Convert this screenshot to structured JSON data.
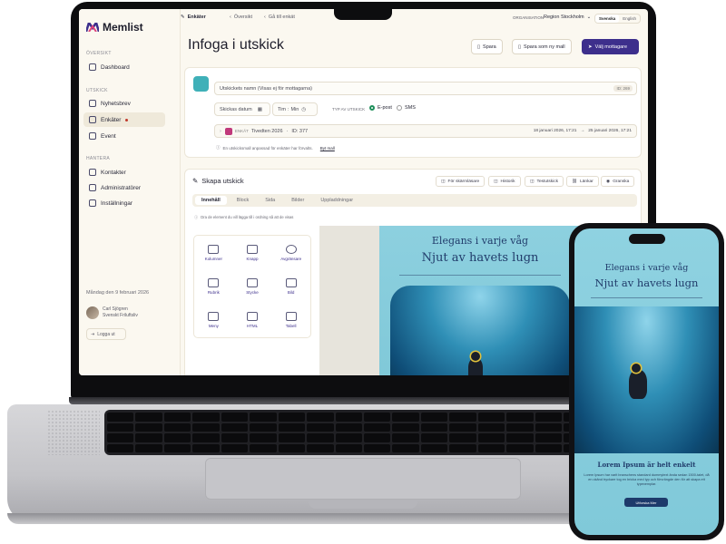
{
  "app": {
    "logo_text": "Memlist",
    "brand_color": "#3d2f8c",
    "accent_teal": "#3fb0b8"
  },
  "sidebar": {
    "section_overview": "ÖVERSIKT",
    "section_outreach": "UTSKICK",
    "section_manage": "HANTERA",
    "items": [
      {
        "label": "Dashboard",
        "icon": "dashboard-icon"
      },
      {
        "label": "Nyhetsbrev",
        "icon": "newsletter-icon"
      },
      {
        "label": "Enkäter",
        "icon": "survey-icon"
      },
      {
        "label": "Event",
        "icon": "event-icon"
      },
      {
        "label": "Kontakter",
        "icon": "contacts-icon"
      },
      {
        "label": "Administratörer",
        "icon": "admins-icon"
      },
      {
        "label": "Inställningar",
        "icon": "settings-icon"
      }
    ],
    "date": "Måndag den 9 februari 2026",
    "user_name": "Carl Sjögren",
    "user_org": "Svenskt Friluftsliv",
    "logout": "Logga ut"
  },
  "topbar": {
    "section": "Enkäter",
    "back": "Översikt",
    "goto": "Gå till enkät",
    "org_label": "ORGANISATION",
    "org_value": "Region Stockholm",
    "lang_sv": "Svenska",
    "lang_en": "English"
  },
  "header": {
    "title": "Infoga i utskick",
    "save": "Spara",
    "save_as_new": "Spara som ny mall",
    "choose_recipients": "Välj mottagare"
  },
  "send_form": {
    "name_placeholder": "Utskickets namn  (Visas ej för mottagarna)",
    "id_chip": "ID: 269",
    "send_date": "Skickas datum",
    "hour": "Tim",
    "minute": "Min",
    "type_label": "TYP AV UTSKICK",
    "type_email": "E-post",
    "type_sms": "SMS",
    "survey_tag": "ENKÄT",
    "survey_name": "Tivedten 2026",
    "survey_id": "ID: 377",
    "date_from": "18 januari 2026, 17:21",
    "date_to": "25 januari 2026, 17:21",
    "info": "En utskicksmall anpassad för enkäter har förvalts.",
    "info_link": "Byt mall"
  },
  "editor": {
    "title": "Skapa utskick",
    "tools": [
      "För skärmläsare",
      "Historik",
      "Testutskick",
      "Länkar",
      "Granska"
    ],
    "tabs": [
      "Innehåll",
      "Block",
      "Sida",
      "Bilder",
      "Uppladdningar"
    ],
    "hint": "Dra de element du vill lägga till i ordning så att de visas",
    "blocks": [
      {
        "label": "Kolumner",
        "icon": "columns-icon"
      },
      {
        "label": "Knapp",
        "icon": "button-icon"
      },
      {
        "label": "Avgränsare",
        "icon": "divider-icon"
      },
      {
        "label": "Rubrik",
        "icon": "heading-icon"
      },
      {
        "label": "Stycke",
        "icon": "paragraph-icon"
      },
      {
        "label": "Bild",
        "icon": "image-icon"
      },
      {
        "label": "Meny",
        "icon": "menu-icon"
      },
      {
        "label": "HTML",
        "icon": "html-icon"
      },
      {
        "label": "Tabell",
        "icon": "table-icon"
      }
    ]
  },
  "email_preview": {
    "headline_1": "Elegans i varje våg",
    "headline_2": "Njut av havets lugn"
  },
  "phone_preview": {
    "headline_1": "Elegans i varje våg",
    "headline_2": "Njut av havets lugn",
    "subheading": "Lorem Ipsum är helt enkelt",
    "body": "Lorem Ipsum har varit branschens standard dummytext ända sedan 1500-talet, då en okänd tryckare tog en bricka med typ och förvrängde den för att skapa ett typexemplar.",
    "cta": "Utforska Mer"
  }
}
